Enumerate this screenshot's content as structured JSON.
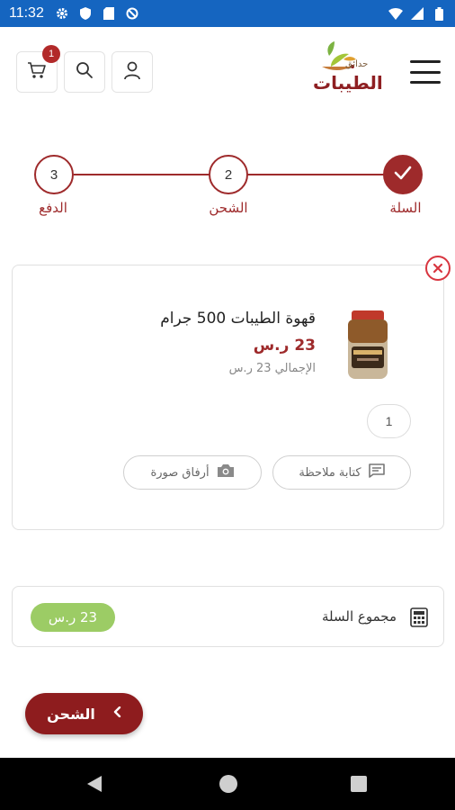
{
  "status_bar": {
    "time": "11:32"
  },
  "header": {
    "logo_subtitle": "حدائق",
    "logo_title": "الطيبات",
    "cart_count": "1"
  },
  "stepper": {
    "steps": [
      {
        "number": "",
        "label": "السلة",
        "state": "done"
      },
      {
        "number": "2",
        "label": "الشحن",
        "state": "pending"
      },
      {
        "number": "3",
        "label": "الدفع",
        "state": "pending"
      }
    ]
  },
  "cart_item": {
    "name": "قهوة الطيبات 500 جرام",
    "price": "23 ر.س",
    "total": "الإجمالي 23 ر.س",
    "quantity": "1",
    "write_note_label": "كتابة ملاحظة",
    "attach_photo_label": "أرفاق صورة"
  },
  "summary": {
    "label": "مجموع السلة",
    "amount": "23 ر.س"
  },
  "next_button": {
    "label": "الشحن"
  },
  "colors": {
    "brand": "#9e2a2b",
    "status_bar": "#1565c0",
    "total_badge": "#9ccc65"
  }
}
